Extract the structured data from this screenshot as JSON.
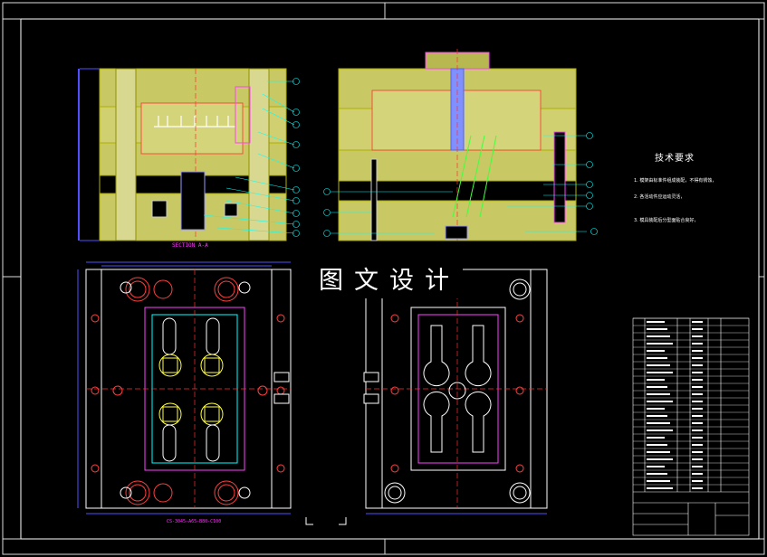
{
  "watermark": "图文设计",
  "section_label": "SECTION A-A",
  "technical_requirements": {
    "title": "技术要求",
    "lines": [
      "1. 模架由标准件组成装配，不得有锈蚀，",
      "2. 各活动件应运动灵活，",
      "3. 模具装配后分型面贴合良好，"
    ]
  },
  "bottom_dimension_label": "CS-3045-A65-B80-C100"
}
